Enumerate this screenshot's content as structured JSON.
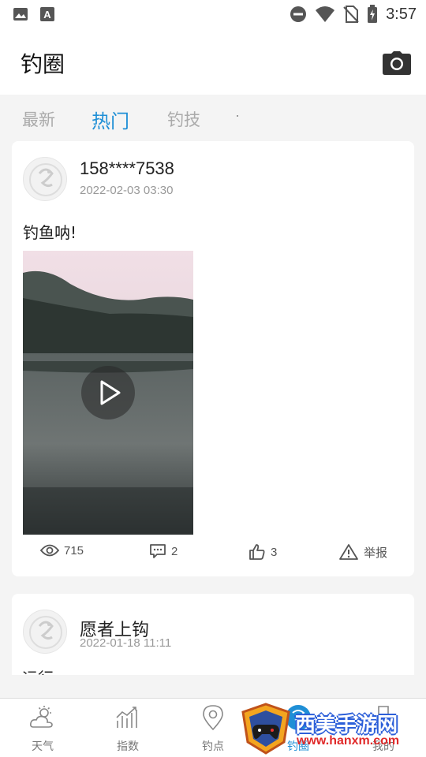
{
  "status_bar": {
    "time": "3:57",
    "icons_left": [
      "image-icon",
      "a-notification-icon"
    ],
    "icons_right": [
      "dnd-icon",
      "wifi-icon",
      "no-sim-icon",
      "battery-charging-icon"
    ]
  },
  "app_bar": {
    "title": "钓圈",
    "action_icon": "camera-icon"
  },
  "tabs": [
    {
      "label": "最新",
      "active": false
    },
    {
      "label": "热门",
      "active": true
    },
    {
      "label": "钓技",
      "active": false
    }
  ],
  "posts": [
    {
      "username": "158****7538",
      "time": "2022-02-03 03:30",
      "text": "钓鱼呐!",
      "views": "715",
      "comments": "2",
      "likes": "3",
      "report_label": "举报"
    },
    {
      "username": "愿者上钩",
      "time": "2022-01-18 11:11",
      "text": "运行"
    }
  ],
  "bottom_nav": [
    {
      "label": "天气",
      "icon": "weather-icon"
    },
    {
      "label": "指数",
      "icon": "chart-icon"
    },
    {
      "label": "钓点",
      "icon": "location-icon"
    },
    {
      "label": "钓圈",
      "icon": "circle-icon",
      "active": true
    },
    {
      "label": "我的",
      "icon": "profile-icon"
    }
  ],
  "watermark": {
    "text": "西美手游网",
    "url": "www.hanxm.com"
  },
  "colors": {
    "accent": "#1f8fd6",
    "background": "#f4f4f4"
  }
}
